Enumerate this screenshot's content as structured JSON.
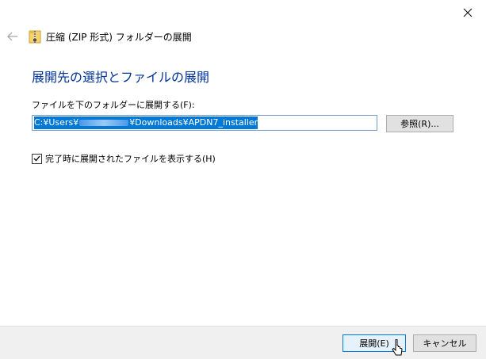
{
  "window": {
    "title": "圧縮 (ZIP 形式) フォルダーの展開",
    "close_icon": "close-icon",
    "back_icon": "back-arrow-icon",
    "zip_icon": "zip-folder-icon"
  },
  "main": {
    "heading": "展開先の選択とファイルの展開",
    "destination_label": "ファイルを下のフォルダーに展開する(F):",
    "destination_path_prefix": "C:¥Users¥",
    "destination_path_suffix": "¥Downloads¥APDN7_installer",
    "browse_label": "参照(R)...",
    "show_files_label": "完了時に展開されたファイルを表示する(H)",
    "show_files_checked": true
  },
  "footer": {
    "extract_label": "展開(E)",
    "cancel_label": "キャンセル"
  },
  "colors": {
    "heading": "#003399",
    "selection": "#0078d7",
    "footer_bg": "#f0f0f0",
    "default_button_border": "#0078d7"
  }
}
